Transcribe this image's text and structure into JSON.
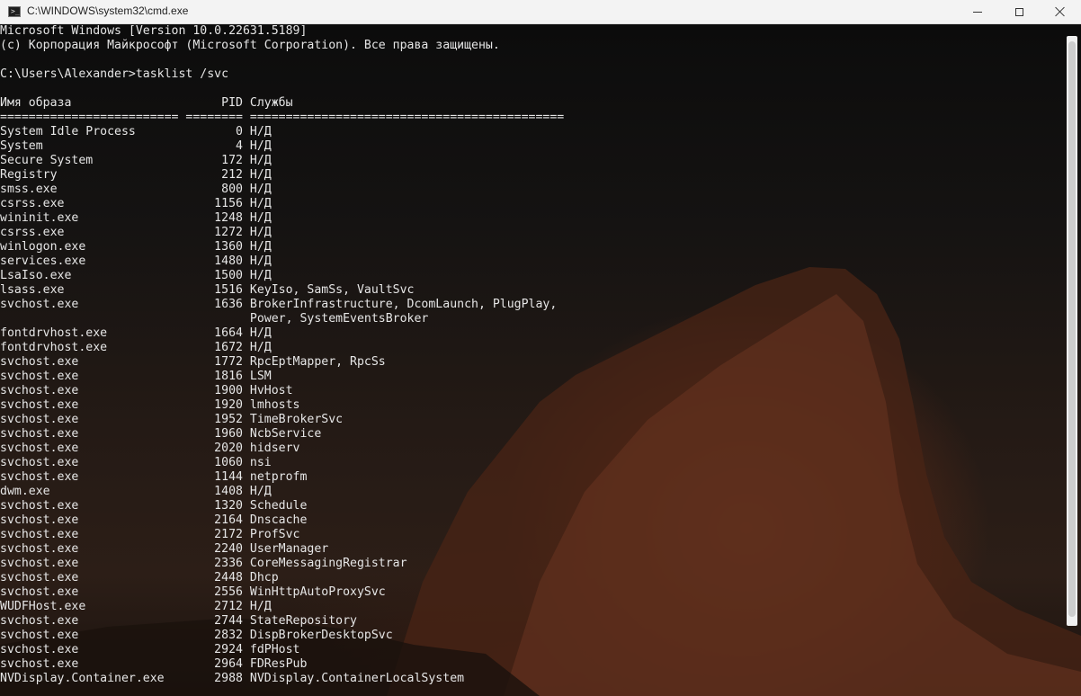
{
  "window": {
    "title": "C:\\WINDOWS\\system32\\cmd.exe",
    "app_icon": "cmd-icon",
    "app_icon_glyph": ">_",
    "controls": [
      "minimize-icon",
      "maximize-icon",
      "close-icon"
    ]
  },
  "console": {
    "lines": [
      "Microsoft Windows [Version 10.0.22631.5189]",
      "(с) Корпорация Майкрософт (Microsoft Corporation). Все права защищены.",
      "",
      "C:\\Users\\Alexander>tasklist /svc",
      "",
      "Имя образа                     PID Службы",
      "========================= ======== ============================================",
      "System Idle Process              0 Н/Д",
      "System                           4 Н/Д",
      "Secure System                  172 Н/Д",
      "Registry                       212 Н/Д",
      "smss.exe                       800 Н/Д",
      "csrss.exe                     1156 Н/Д",
      "wininit.exe                   1248 Н/Д",
      "csrss.exe                     1272 Н/Д",
      "winlogon.exe                  1360 Н/Д",
      "services.exe                  1480 Н/Д",
      "LsaIso.exe                    1500 Н/Д",
      "lsass.exe                     1516 KeyIso, SamSs, VaultSvc",
      "svchost.exe                   1636 BrokerInfrastructure, DcomLaunch, PlugPlay,",
      "                                   Power, SystemEventsBroker",
      "fontdrvhost.exe               1664 Н/Д",
      "fontdrvhost.exe               1672 Н/Д",
      "svchost.exe                   1772 RpcEptMapper, RpcSs",
      "svchost.exe                   1816 LSM",
      "svchost.exe                   1900 HvHost",
      "svchost.exe                   1920 lmhosts",
      "svchost.exe                   1952 TimeBrokerSvc",
      "svchost.exe                   1960 NcbService",
      "svchost.exe                   2020 hidserv",
      "svchost.exe                   1060 nsi",
      "svchost.exe                   1144 netprofm",
      "dwm.exe                       1408 Н/Д",
      "svchost.exe                   1320 Schedule",
      "svchost.exe                   2164 Dnscache",
      "svchost.exe                   2172 ProfSvc",
      "svchost.exe                   2240 UserManager",
      "svchost.exe                   2336 CoreMessagingRegistrar",
      "svchost.exe                   2448 Dhcp",
      "svchost.exe                   2556 WinHttpAutoProxySvc",
      "WUDFHost.exe                  2712 Н/Д",
      "svchost.exe                   2744 StateRepository",
      "svchost.exe                   2832 DispBrokerDesktopSvc",
      "svchost.exe                   2924 fdPHost",
      "svchost.exe                   2964 FDResPub",
      "NVDisplay.Container.exe       2988 NVDisplay.ContainerLocalSystem"
    ]
  },
  "colors": {
    "text": "#e6e6e6",
    "titlebar": "#f3f3f3",
    "rock": "#5a2c1c"
  }
}
